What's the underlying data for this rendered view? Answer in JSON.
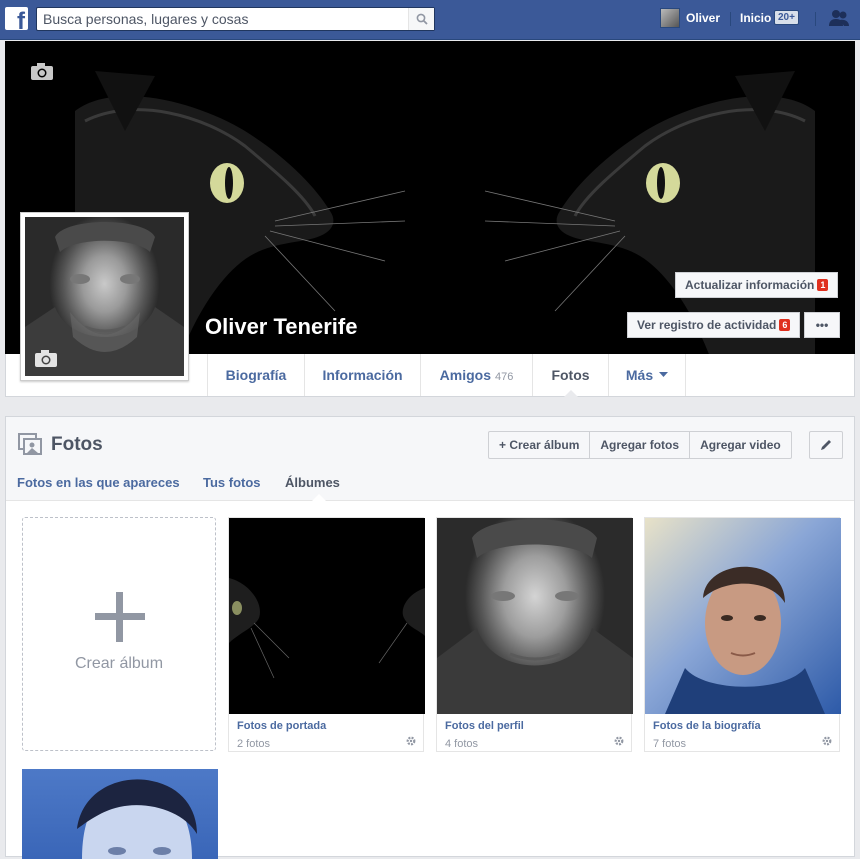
{
  "topbar": {
    "search_placeholder": "Busca personas, lugares y cosas",
    "user_name": "Oliver",
    "home_label": "Inicio",
    "home_badge": "20+"
  },
  "profile": {
    "name": "Oliver Tenerife",
    "update_info_label": "Actualizar información",
    "update_info_badge": "1",
    "activity_log_label": "Ver registro de actividad",
    "activity_log_badge": "6",
    "more_label": "•••"
  },
  "tabs": [
    {
      "label": "Biografía"
    },
    {
      "label": "Información"
    },
    {
      "label": "Amigos",
      "count": "476"
    },
    {
      "label": "Fotos",
      "active": true
    },
    {
      "label": "Más"
    }
  ],
  "photos": {
    "title": "Fotos",
    "create_album_label": "+ Crear álbum",
    "add_photos_label": "Agregar fotos",
    "add_video_label": "Agregar video",
    "subtabs": [
      "Fotos en las que apareces",
      "Tus fotos",
      "Álbumes"
    ],
    "active_subtab": "Álbumes",
    "create_album_card": "Crear álbum",
    "albums": [
      {
        "title": "Fotos de portada",
        "count": "2 fotos"
      },
      {
        "title": "Fotos del perfil",
        "count": "4 fotos"
      },
      {
        "title": "Fotos de la biografía",
        "count": "7 fotos"
      }
    ]
  },
  "colors": {
    "brand": "#3b5998",
    "link": "#4b6aa0",
    "badge_red": "#e0301e"
  }
}
